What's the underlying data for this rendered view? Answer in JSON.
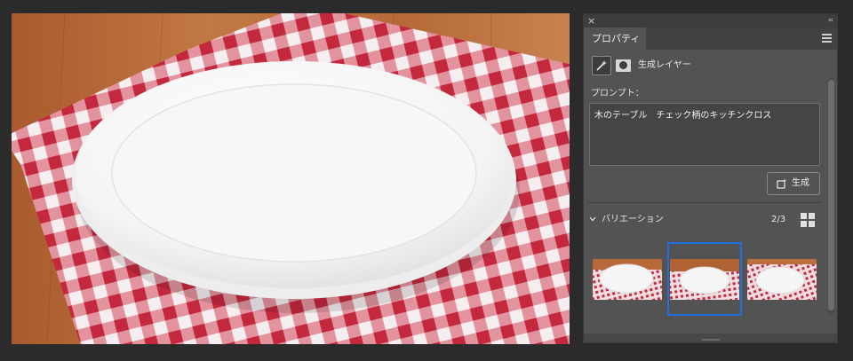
{
  "panel": {
    "close_glyph": "×",
    "collapse_glyph": "‹‹",
    "tab_label": "プロパティ",
    "menu_icon": "hamburger-icon"
  },
  "layer": {
    "icons": [
      "magic-wand-icon",
      "mask-icon"
    ],
    "label": "生成レイヤー"
  },
  "prompt": {
    "label": "プロンプト：",
    "value": "木のテーブル　チェック柄のキッチンクロス"
  },
  "generate_button": {
    "label": "生成",
    "icon": "generate-icon"
  },
  "variations": {
    "label": "バリエーション",
    "count": "2/3",
    "selected_index": 2,
    "total": 3,
    "view_icon": "grid-view-icon",
    "expanded": true
  },
  "colors": {
    "accent": "#1f6fe3",
    "panel_bg": "#535353",
    "app_bg": "#2b2b2b"
  }
}
